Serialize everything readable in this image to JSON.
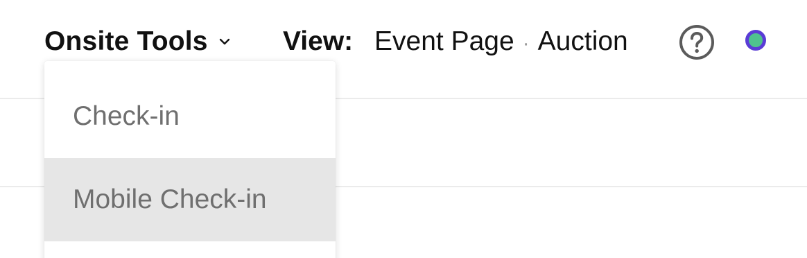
{
  "header": {
    "tools_menu_label": "Onsite Tools",
    "view_label": "View:",
    "view_primary": "Event Page",
    "view_separator": "·",
    "view_secondary": "Auction"
  },
  "icons": {
    "tools_chevron": "chevron-down-icon",
    "help": "help-circle-icon",
    "status": "status-dot-icon"
  },
  "colors": {
    "status_dot_fill": "#4fc28e",
    "status_dot_ring": "#5a3cd6",
    "menu_hover_bg": "#e6e6e6"
  },
  "dropdown": {
    "items": [
      {
        "label": "Check-in"
      },
      {
        "label": "Mobile Check-in"
      }
    ]
  }
}
